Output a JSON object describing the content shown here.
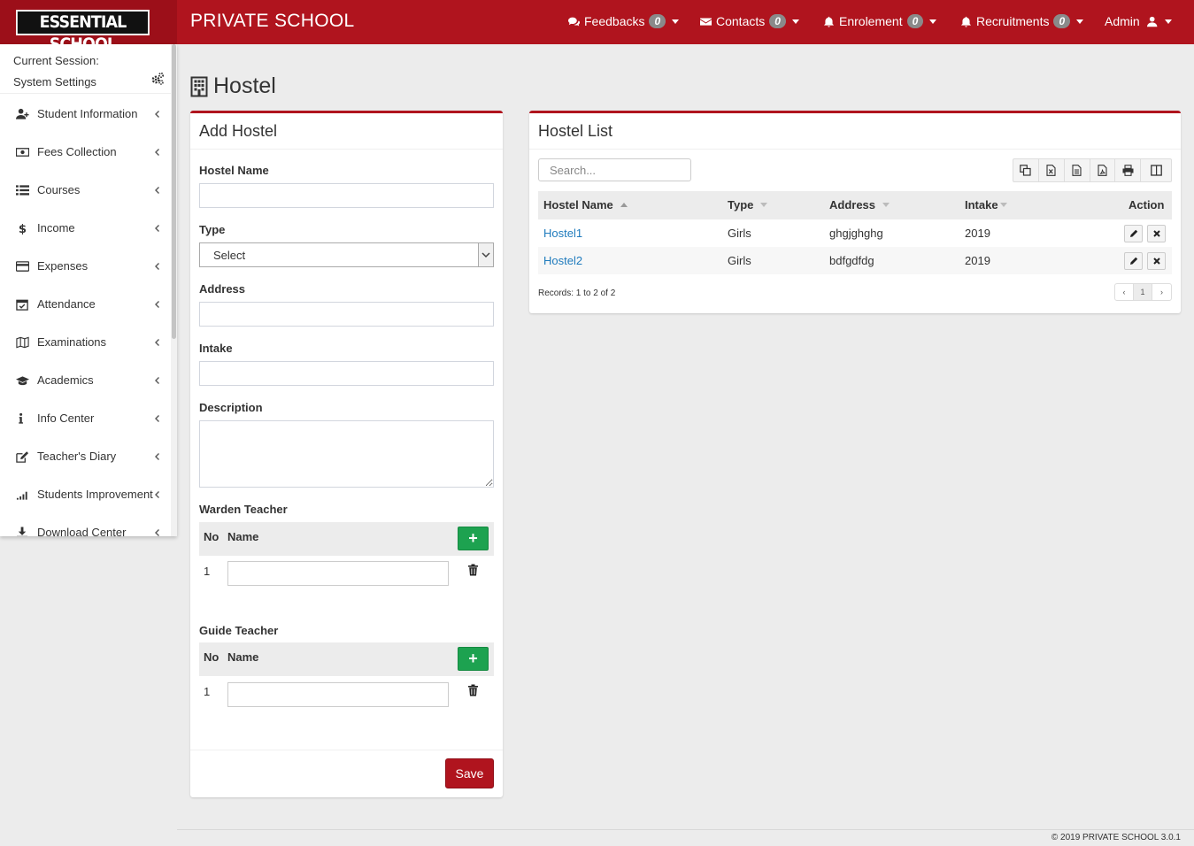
{
  "header": {
    "logo_text": "ESSENTIAL SCHOOL",
    "app_title": "PRIVATE SCHOOL",
    "nav": [
      {
        "label": "Feedbacks",
        "count": "0",
        "icon": "comments-icon"
      },
      {
        "label": "Contacts",
        "count": "0",
        "icon": "envelope-icon"
      },
      {
        "label": "Enrolement",
        "count": "0",
        "icon": "bell-icon"
      },
      {
        "label": "Recruitments",
        "count": "0",
        "icon": "bell-icon"
      }
    ],
    "user_label": "Admin"
  },
  "sidebar": {
    "session_label": "Current Session:",
    "settings_label": "System Settings",
    "items": [
      {
        "label": "Student Information",
        "icon": "user-plus-icon"
      },
      {
        "label": "Fees Collection",
        "icon": "money-icon"
      },
      {
        "label": "Courses",
        "icon": "list-icon"
      },
      {
        "label": "Income",
        "icon": "dollar-icon"
      },
      {
        "label": "Expenses",
        "icon": "credit-card-icon"
      },
      {
        "label": "Attendance",
        "icon": "calendar-check-icon"
      },
      {
        "label": "Examinations",
        "icon": "map-icon"
      },
      {
        "label": "Academics",
        "icon": "graduation-cap-icon"
      },
      {
        "label": "Info Center",
        "icon": "info-icon"
      },
      {
        "label": "Teacher's Diary",
        "icon": "edit-icon"
      },
      {
        "label": "Students Improvement",
        "icon": "signal-icon"
      },
      {
        "label": "Download Center",
        "icon": "download-icon"
      }
    ]
  },
  "page": {
    "title": "Hostel"
  },
  "add_hostel": {
    "title": "Add Hostel",
    "hostel_name_label": "Hostel Name",
    "hostel_name_value": "",
    "type_label": "Type",
    "type_selected": "Select",
    "address_label": "Address",
    "address_value": "",
    "intake_label": "Intake",
    "intake_value": "",
    "description_label": "Description",
    "description_value": "",
    "warden_label": "Warden Teacher",
    "guide_label": "Guide Teacher",
    "col_no": "No",
    "col_name": "Name",
    "add_symbol": "+",
    "warden_rows": [
      {
        "no": "1",
        "value": ""
      }
    ],
    "guide_rows": [
      {
        "no": "1",
        "value": ""
      }
    ],
    "save_label": "Save"
  },
  "hostel_list": {
    "title": "Hostel List",
    "search_placeholder": "Search...",
    "columns": [
      "Hostel Name",
      "Type",
      "Address",
      "Intake",
      "Action"
    ],
    "rows": [
      {
        "name": "Hostel1",
        "type": "Girls",
        "address": "ghgjghghg",
        "intake": "2019"
      },
      {
        "name": "Hostel2",
        "type": "Girls",
        "address": "bdfgdfdg",
        "intake": "2019"
      }
    ],
    "records_text": "Records: 1 to 2 of 2",
    "pager": {
      "prev": "‹",
      "page": "1",
      "next": "›"
    }
  },
  "footer": {
    "text": "© 2019 PRIVATE SCHOOL 3.0.1"
  },
  "colors": {
    "brand_red": "#b0141e",
    "add_green": "#1da250",
    "link_blue": "#1f7bbd"
  }
}
